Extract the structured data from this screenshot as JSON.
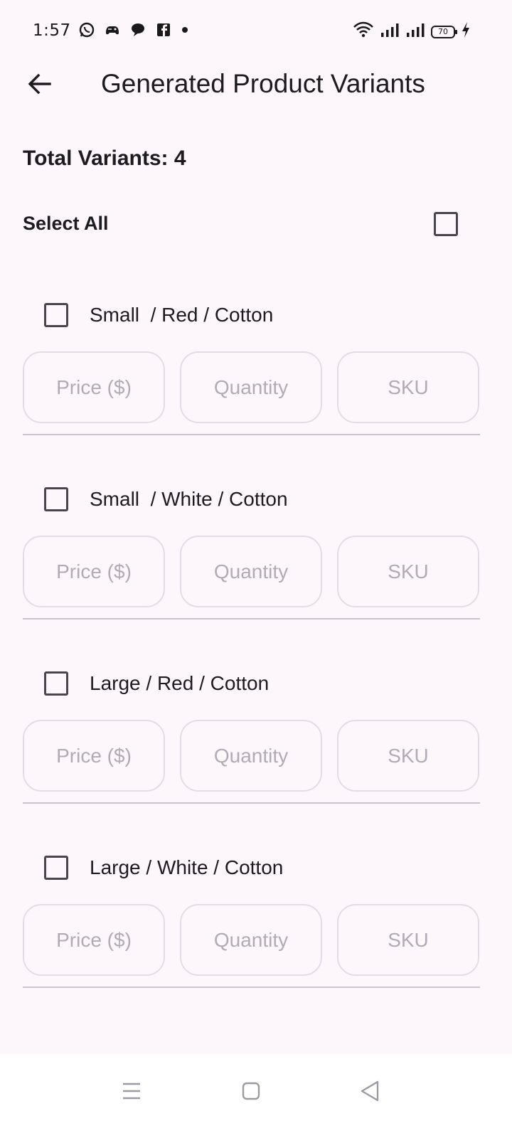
{
  "status_bar": {
    "time": "1:57",
    "battery": "70",
    "icons": [
      "whatsapp-icon",
      "game-controller-icon",
      "chat-bubble-icon",
      "facebook-icon",
      "dot-icon",
      "wifi-icon",
      "signal-icon",
      "signal-icon",
      "battery-icon",
      "charging-icon"
    ]
  },
  "app_bar": {
    "title": "Generated Product Variants",
    "back_icon": "arrow-back-icon"
  },
  "summary": {
    "total_label": "Total Variants: 4"
  },
  "select_all": {
    "label": "Select All",
    "checked": false
  },
  "variants": [
    {
      "name": "Small  / Red / Cotton",
      "checked": false,
      "price_placeholder": "Price ($)",
      "quantity_placeholder": "Quantity",
      "sku_placeholder": "SKU"
    },
    {
      "name": "Small  / White / Cotton",
      "checked": false,
      "price_placeholder": "Price ($)",
      "quantity_placeholder": "Quantity",
      "sku_placeholder": "SKU"
    },
    {
      "name": "Large / Red / Cotton",
      "checked": false,
      "price_placeholder": "Price ($)",
      "quantity_placeholder": "Quantity",
      "sku_placeholder": "SKU"
    },
    {
      "name": "Large / White / Cotton",
      "checked": false,
      "price_placeholder": "Price ($)",
      "quantity_placeholder": "Quantity",
      "sku_placeholder": "SKU"
    }
  ],
  "nav_bar": {
    "icons": [
      "menu-icon",
      "home-square-icon",
      "back-triangle-icon"
    ]
  },
  "colors": {
    "background": "#fdf7fc",
    "text": "#1d1b20",
    "checkbox_border": "#49454f",
    "field_border": "#e3dce6",
    "placeholder": "#b2abb5",
    "divider": "#cac4cf"
  }
}
